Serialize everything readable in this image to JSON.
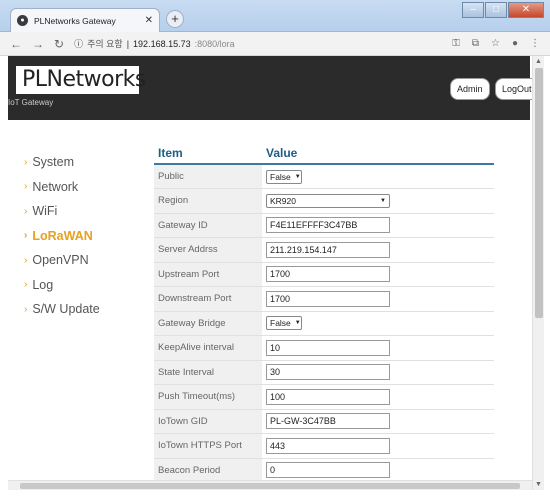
{
  "browser": {
    "tab_title": "PLNetworks Gateway",
    "tab_close": "✕",
    "new_tab": "+",
    "insecure_label": "주의 요함",
    "url_host": "192.168.15.73",
    "url_rest": ":8080/lora",
    "window_buttons": {
      "minimize": "–",
      "maximize": "□",
      "close": "✕"
    }
  },
  "header": {
    "logo_text": "PLNetworks",
    "subtitle": "IoT Gateway",
    "admin_label": "Admin",
    "logout_label": "LogOut"
  },
  "sidebar": {
    "items": [
      {
        "label": "System",
        "active": false
      },
      {
        "label": "Network",
        "active": false
      },
      {
        "label": "WiFi",
        "active": false
      },
      {
        "label": "LoRaWAN",
        "active": true
      },
      {
        "label": "OpenVPN",
        "active": false
      },
      {
        "label": "Log",
        "active": false
      },
      {
        "label": "S/W Update",
        "active": false
      }
    ]
  },
  "table": {
    "col_item": "Item",
    "col_value": "Value",
    "rows": [
      {
        "item": "Public",
        "type": "select",
        "value": "False"
      },
      {
        "item": "Region",
        "type": "select-wide",
        "value": "KR920"
      },
      {
        "item": "Gateway ID",
        "type": "text",
        "value": "F4E11EFFFF3C47BB"
      },
      {
        "item": "Server Addrss",
        "type": "text",
        "value": "211.219.154.147"
      },
      {
        "item": "Upstream Port",
        "type": "text",
        "value": "1700"
      },
      {
        "item": "Downstream Port",
        "type": "text",
        "value": "1700"
      },
      {
        "item": "Gateway Bridge",
        "type": "select",
        "value": "False"
      },
      {
        "item": "KeepAlive interval",
        "type": "text",
        "value": "10"
      },
      {
        "item": "State Interval",
        "type": "text",
        "value": "30"
      },
      {
        "item": "Push Timeout(ms)",
        "type": "text",
        "value": "100"
      },
      {
        "item": "IoTown GID",
        "type": "text",
        "value": "PL-GW-3C47BB"
      },
      {
        "item": "IoTown HTTPS Port",
        "type": "text",
        "value": "443"
      },
      {
        "item": "Beacon Period",
        "type": "text",
        "value": "0"
      }
    ]
  },
  "colors": {
    "accent": "#e8a020",
    "header_bg": "#2b2b2b",
    "table_header": "#1f5e86"
  }
}
